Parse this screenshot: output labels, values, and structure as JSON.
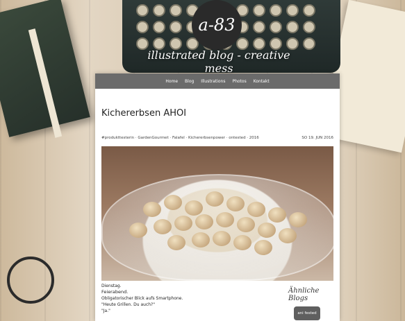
{
  "brand": {
    "logo_text": "a-83",
    "tagline": "illustrated blog - creative mess"
  },
  "nav": {
    "items": [
      {
        "label": "Home"
      },
      {
        "label": "Blog"
      },
      {
        "label": "Illustrations"
      },
      {
        "label": "Photos"
      },
      {
        "label": "Kontakt"
      }
    ]
  },
  "post": {
    "title": "Kichererbsen AHOI",
    "meta": "#produkttesterin · GardenGourmet · Falafel · Kichererbsenpower · ontested · 2016",
    "date": "SO 19. JUN 2016",
    "body": [
      "Dienstag.",
      "Feierabend.",
      "Obligatorischer Blick aufs Smartphone.",
      "\"Heute Grillen. Du auch?\"",
      "\"Ja.\""
    ]
  },
  "sidebar": {
    "title": "Ähnliche Blogs",
    "button_label": "ani fested"
  }
}
